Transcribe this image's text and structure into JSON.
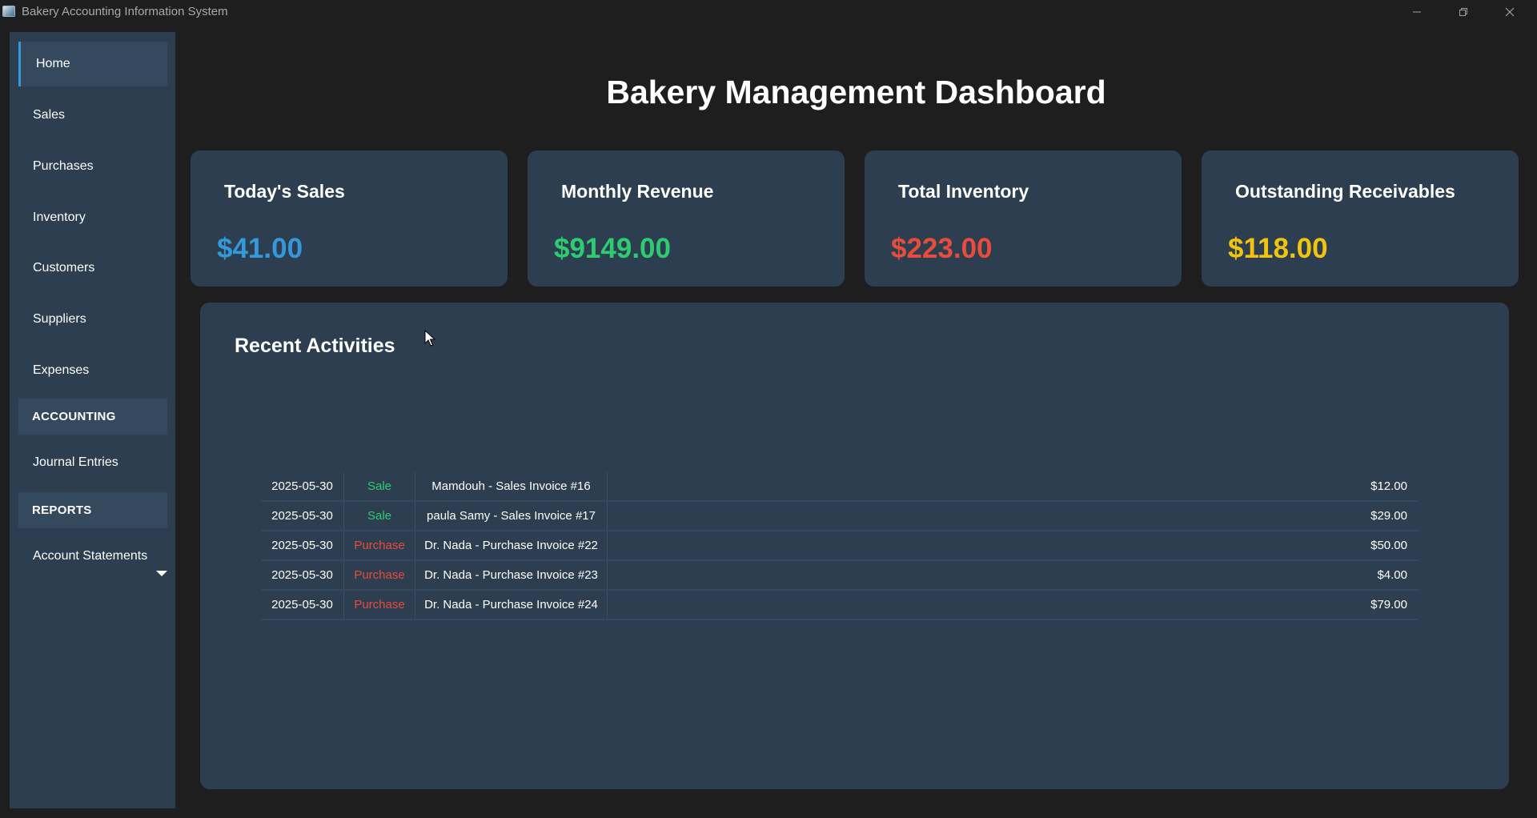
{
  "window": {
    "title": "Bakery Accounting Information System",
    "controls": [
      "minimize-icon",
      "maximize-icon",
      "close-icon"
    ]
  },
  "sidebar": {
    "items": [
      {
        "label": "Home",
        "active": true
      },
      {
        "label": "Sales"
      },
      {
        "label": "Purchases"
      },
      {
        "label": "Inventory"
      },
      {
        "label": "Customers"
      },
      {
        "label": "Suppliers"
      },
      {
        "label": "Expenses"
      }
    ],
    "accounting_header": "ACCOUNTING",
    "accounting_items": [
      {
        "label": "Journal Entries"
      }
    ],
    "reports_header": "REPORTS",
    "reports_items": [
      {
        "label": "Account Statements"
      }
    ]
  },
  "main": {
    "title": "Bakery Management Dashboard",
    "cards": [
      {
        "label": "Today's Sales",
        "value": "$41.00",
        "color": "#3498db"
      },
      {
        "label": "Monthly Revenue",
        "value": "$9149.00",
        "color": "#2ecc71"
      },
      {
        "label": "Total Inventory",
        "value": "$223.00",
        "color": "#e74c3c"
      },
      {
        "label": "Outstanding Receivables",
        "value": "$118.00",
        "color": "#f1c40f"
      }
    ],
    "activities": {
      "title": "Recent Activities",
      "rows": [
        {
          "date": "2025-05-30",
          "type": "Sale",
          "description": "Mamdouh - Sales Invoice #16",
          "amount": "$12.00"
        },
        {
          "date": "2025-05-30",
          "type": "Sale",
          "description": "paula Samy - Sales Invoice #17",
          "amount": "$29.00"
        },
        {
          "date": "2025-05-30",
          "type": "Purchase",
          "description": "Dr. Nada - Purchase Invoice #22",
          "amount": "$50.00"
        },
        {
          "date": "2025-05-30",
          "type": "Purchase",
          "description": "Dr. Nada - Purchase Invoice #23",
          "amount": "$4.00"
        },
        {
          "date": "2025-05-30",
          "type": "Purchase",
          "description": "Dr. Nada - Purchase Invoice #24",
          "amount": "$79.00"
        }
      ]
    }
  },
  "colors": {
    "sale": "#2ecc71",
    "purchase": "#e74c3c",
    "panel": "#2c3e50",
    "accent": "#3498db"
  }
}
